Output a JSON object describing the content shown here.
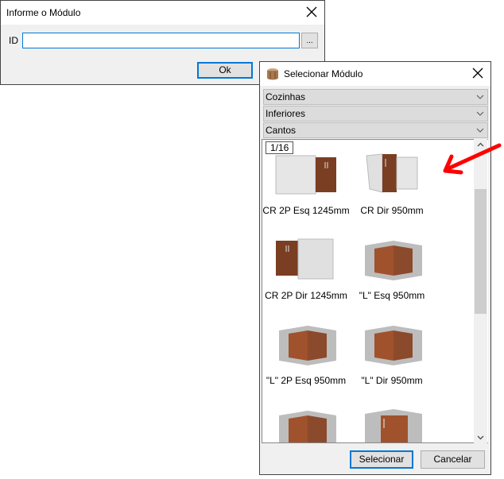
{
  "dialog_id": {
    "title": "Informe o Módulo",
    "id_label": "ID",
    "id_value": "",
    "browse_label": "...",
    "ok_label": "Ok"
  },
  "dialog_select": {
    "title": "Selecionar Módulo",
    "accordion": [
      {
        "label": "Cozinhas"
      },
      {
        "label": "Inferiores"
      },
      {
        "label": "Cantos"
      }
    ],
    "page_indicator": "1/16",
    "items": [
      {
        "label": "CR 2P Esq 1245mm",
        "type": "flat-left"
      },
      {
        "label": "CR Dir 950mm",
        "type": "flat-right"
      },
      {
        "label": "CR 2P Dir 1245mm",
        "type": "flat-left2"
      },
      {
        "label": "\"L\" Esq 950mm",
        "type": "l"
      },
      {
        "label": "\"L\" 2P Esq 950mm",
        "type": "l"
      },
      {
        "label": "\"L\" Dir 950mm",
        "type": "l"
      },
      {
        "label": "",
        "type": "l"
      },
      {
        "label": "",
        "type": "diag"
      }
    ],
    "select_label": "Selecionar",
    "cancel_label": "Cancelar"
  },
  "colors": {
    "accent": "#0078d7",
    "arrow": "#ff0000",
    "wood": "#8a4a2a"
  }
}
